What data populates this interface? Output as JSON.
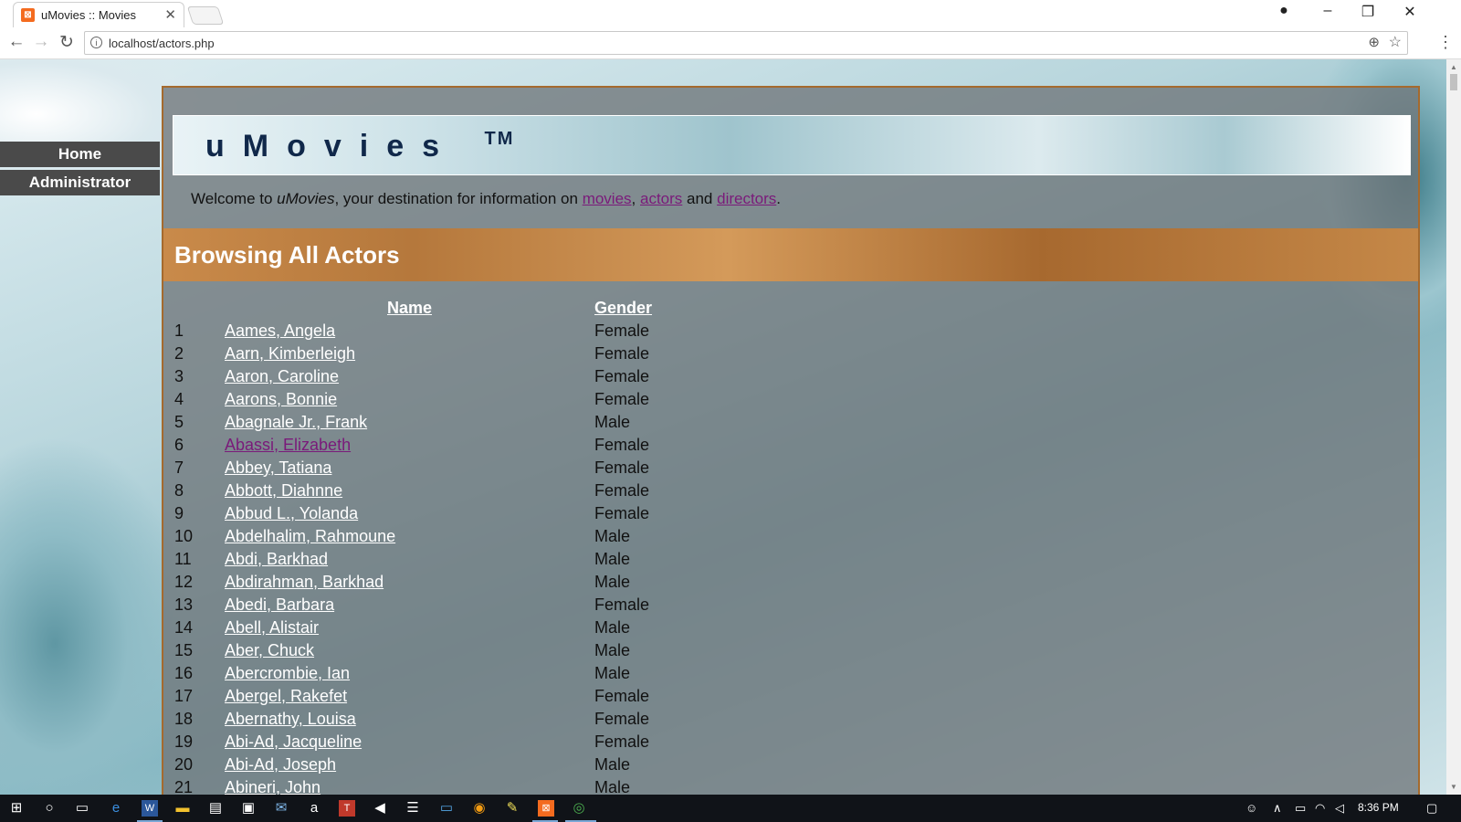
{
  "browser": {
    "tab_title": "uMovies :: Movies",
    "favicon": "xampp-icon",
    "url": "localhost/actors.php"
  },
  "sidebar": {
    "items": [
      {
        "label": "Home"
      },
      {
        "label": "Administrator"
      }
    ]
  },
  "banner": {
    "logo": "uMovies",
    "trademark": "TM"
  },
  "welcome": {
    "prefix": "Welcome to ",
    "site": "uMovies",
    "middle": ", your destination for information on ",
    "link_movies": "movies",
    "sep": ", ",
    "link_actors": "actors",
    "and": " and ",
    "link_directors": "directors",
    "end": "."
  },
  "section": {
    "title": "Browsing All Actors"
  },
  "table": {
    "headers": {
      "name": "Name",
      "gender": "Gender"
    },
    "rows": [
      {
        "num": "1",
        "name": "Aames, Angela",
        "gender": "Female"
      },
      {
        "num": "2",
        "name": "Aarn, Kimberleigh",
        "gender": "Female"
      },
      {
        "num": "3",
        "name": "Aaron, Caroline",
        "gender": "Female"
      },
      {
        "num": "4",
        "name": "Aarons, Bonnie",
        "gender": "Female"
      },
      {
        "num": "5",
        "name": "Abagnale Jr., Frank",
        "gender": "Male"
      },
      {
        "num": "6",
        "name": "Abassi, Elizabeth",
        "gender": "Female",
        "visited": true
      },
      {
        "num": "7",
        "name": "Abbey, Tatiana",
        "gender": "Female"
      },
      {
        "num": "8",
        "name": "Abbott, Diahnne",
        "gender": "Female"
      },
      {
        "num": "9",
        "name": "Abbud L., Yolanda",
        "gender": "Female"
      },
      {
        "num": "10",
        "name": "Abdelhalim, Rahmoune",
        "gender": "Male"
      },
      {
        "num": "11",
        "name": "Abdi, Barkhad",
        "gender": "Male"
      },
      {
        "num": "12",
        "name": "Abdirahman, Barkhad",
        "gender": "Male"
      },
      {
        "num": "13",
        "name": "Abedi, Barbara",
        "gender": "Female"
      },
      {
        "num": "14",
        "name": "Abell, Alistair",
        "gender": "Male"
      },
      {
        "num": "15",
        "name": "Aber, Chuck",
        "gender": "Male"
      },
      {
        "num": "16",
        "name": "Abercrombie, Ian",
        "gender": "Male"
      },
      {
        "num": "17",
        "name": "Abergel, Rakefet",
        "gender": "Female"
      },
      {
        "num": "18",
        "name": "Abernathy, Louisa",
        "gender": "Female"
      },
      {
        "num": "19",
        "name": "Abi-Ad, Jacqueline",
        "gender": "Female"
      },
      {
        "num": "20",
        "name": "Abi-Ad, Joseph",
        "gender": "Male"
      },
      {
        "num": "21",
        "name": "Abineri, John",
        "gender": "Male"
      }
    ]
  },
  "taskbar": {
    "clock": "8:36 PM"
  },
  "colors": {
    "link_visited": "#7a1a7a",
    "frame_border": "#a56a2e",
    "nav_bg": "#4a4a4a"
  }
}
